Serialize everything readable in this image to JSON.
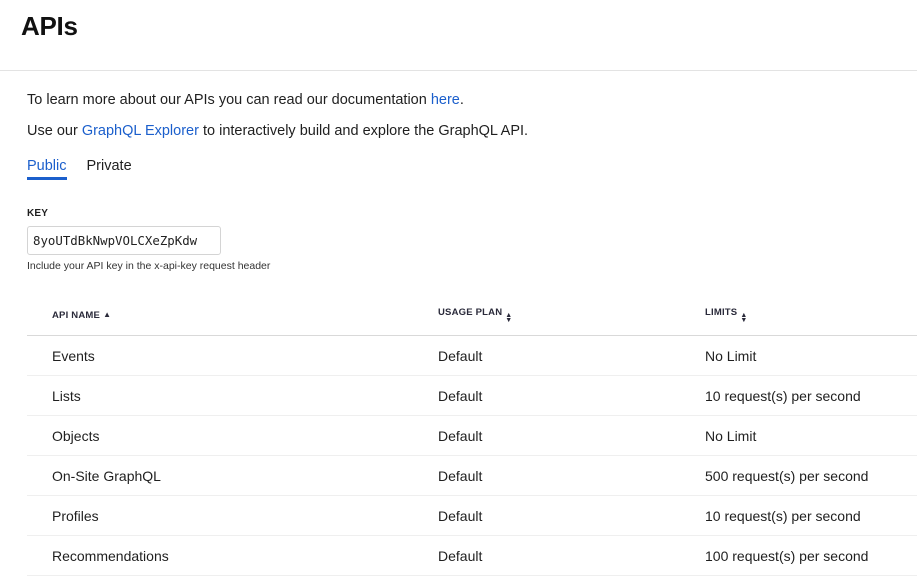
{
  "header": {
    "title": "APIs"
  },
  "intro": {
    "line1_prefix": "To learn more about our APIs you can read our documentation ",
    "line1_link": "here",
    "line1_suffix": ".",
    "line2_prefix": "Use our ",
    "line2_link": "GraphQL Explorer",
    "line2_suffix": " to interactively build and explore the GraphQL API."
  },
  "tabs": [
    {
      "label": "Public",
      "active": true
    },
    {
      "label": "Private",
      "active": false
    }
  ],
  "key": {
    "label": "KEY",
    "value": "8yoUTdBkNwpVOLCXeZpKdw",
    "hint": "Include your API key in the x-api-key request header"
  },
  "table": {
    "columns": [
      {
        "label": "API NAME",
        "sort": "ascending"
      },
      {
        "label": "USAGE PLAN",
        "sort": "none"
      },
      {
        "label": "LIMITS",
        "sort": "none"
      }
    ],
    "rows": [
      {
        "name": "Events",
        "plan": "Default",
        "limit": "No Limit"
      },
      {
        "name": "Lists",
        "plan": "Default",
        "limit": "10 request(s) per second"
      },
      {
        "name": "Objects",
        "plan": "Default",
        "limit": "No Limit"
      },
      {
        "name": "On-Site GraphQL",
        "plan": "Default",
        "limit": "500 request(s) per second"
      },
      {
        "name": "Profiles",
        "plan": "Default",
        "limit": "10 request(s) per second"
      },
      {
        "name": "Recommendations",
        "plan": "Default",
        "limit": "100 request(s) per second"
      }
    ]
  },
  "colors": {
    "link": "#1b5fcc",
    "text": "#1f1f1f",
    "divider": "#e3e3e3"
  },
  "icons": {
    "sort_ascending": "caret-up-icon",
    "sort_both": "caret-up-down-icon"
  }
}
